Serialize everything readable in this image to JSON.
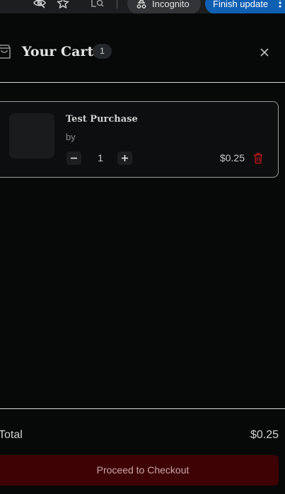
{
  "browser": {
    "incognito_label": "Incognito",
    "update_label": "Finish update",
    "icons": [
      "eye-off-icon",
      "star-icon",
      "lens-icon",
      "incognito-icon",
      "more-vert-icon"
    ]
  },
  "cart": {
    "title": "Your Cart",
    "count": "1",
    "icons": [
      "shopping-bag-icon",
      "close-icon"
    ]
  },
  "items": [
    {
      "name": "Test Purchase",
      "author": "by",
      "quantity": "1",
      "price": "$0.25"
    }
  ],
  "footer": {
    "total_label": "Total",
    "total_value": "$0.25",
    "checkout_label": "Proceed to Checkout"
  },
  "colors": {
    "background": "#070808",
    "checkout_button": "#3e0205",
    "trash_icon": "#b3171c",
    "update_pill": "#0f5fb3"
  }
}
